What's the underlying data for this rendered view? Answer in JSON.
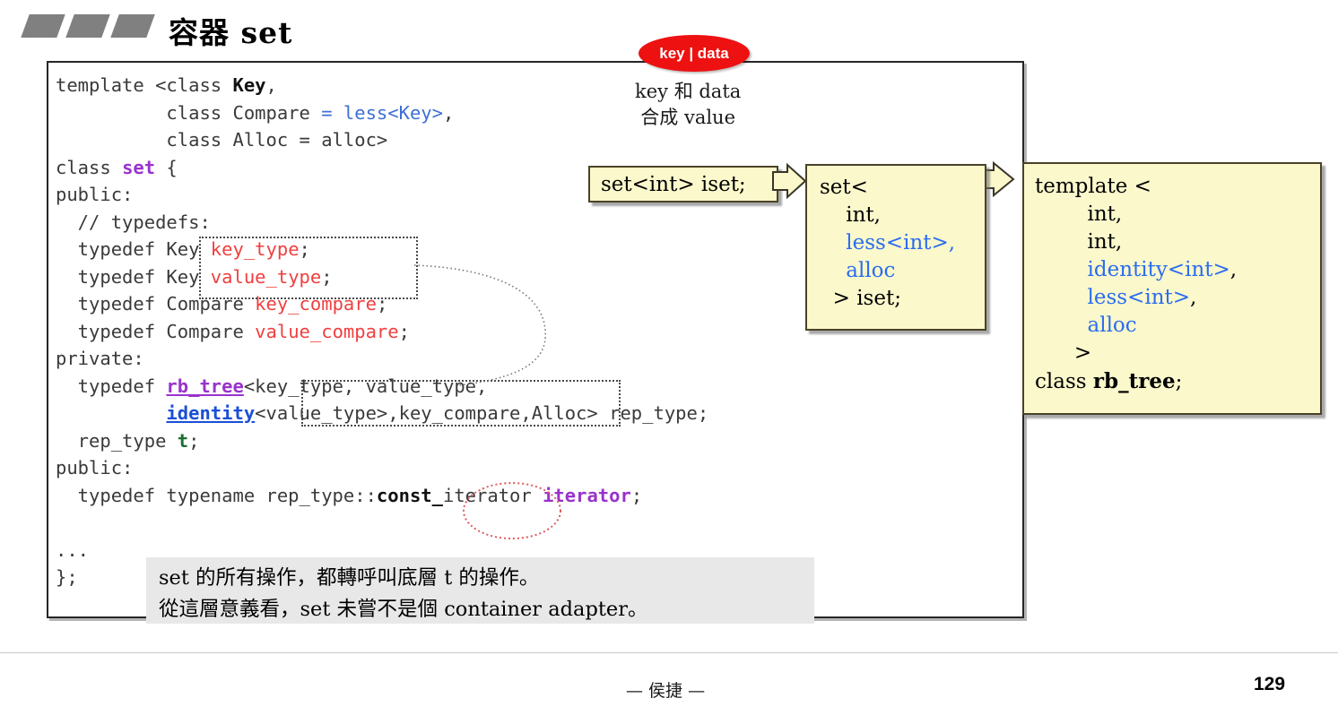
{
  "slide": {
    "title": "容器 set",
    "page_number": "129",
    "author_footer": "— 侯捷 —"
  },
  "callout": {
    "badge": "key | data",
    "note": "key 和 data\n合成 value"
  },
  "code": {
    "lines": [
      "template <class Key,",
      "          class Compare = less<Key>,",
      "          class Alloc = alloc>",
      "class set {",
      "public:",
      "  // typedefs:",
      "  typedef Key key_type;",
      "  typedef Key value_type;",
      "  typedef Compare key_compare;",
      "  typedef Compare value_compare;",
      "private:",
      "  typedef rb_tree<key_type, value_type,",
      "          identity<value_type>,key_compare,Alloc> rep_type;",
      "  rep_type t;",
      "public:",
      "  typedef typename rep_type::const_iterator iterator;",
      "",
      "...",
      "};"
    ]
  },
  "boxes": {
    "declaration": "set<int> iset;",
    "expansion": "set<\n    int,\n    less<int>,\n    alloc\n  > iset;",
    "rbtree": "template <\n        int,\n        int,\n        identity<int>,\n        less<int>,\n        alloc\n      >\nclass rb_tree;"
  },
  "gray_note": "set 的所有操作，都轉呼叫底層 t 的操作。\n從這層意義看，set 未嘗不是個 container adapter。",
  "colors": {
    "accent_red": "#ee1111",
    "code_red": "#ef4040",
    "code_blue": "#3d6fd6",
    "code_purple": "#9933cc",
    "box_yellow": "#fbf8cc",
    "note_gray": "#e8e8e8"
  }
}
